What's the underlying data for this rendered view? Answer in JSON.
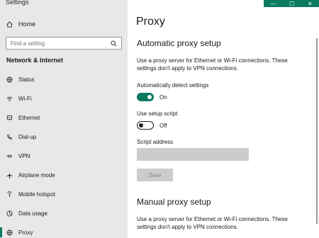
{
  "app": {
    "title": "Settings"
  },
  "sidebar": {
    "home_label": "Home",
    "search_placeholder": "Find a setting",
    "section_label": "Network & Internet",
    "items": [
      {
        "label": "Status",
        "icon": "globe-icon"
      },
      {
        "label": "Wi-Fi",
        "icon": "wifi-icon"
      },
      {
        "label": "Ethernet",
        "icon": "ethernet-icon"
      },
      {
        "label": "Dial-up",
        "icon": "phone-icon"
      },
      {
        "label": "VPN",
        "icon": "vpn-icon"
      },
      {
        "label": "Airplane mode",
        "icon": "airplane-icon"
      },
      {
        "label": "Mobile hotspot",
        "icon": "hotspot-icon"
      },
      {
        "label": "Data usage",
        "icon": "data-usage-icon"
      },
      {
        "label": "Proxy",
        "icon": "globe-icon",
        "selected": true
      }
    ]
  },
  "window_controls": {
    "minimize": "—",
    "maximize": "☐",
    "close": "✕"
  },
  "main": {
    "title": "Proxy",
    "automatic": {
      "heading": "Automatic proxy setup",
      "description": "Use a proxy server for Ethernet or Wi-Fi connections. These settings don't apply to VPN connections.",
      "auto_detect_label": "Automatically detect settings",
      "auto_detect_state": "On",
      "auto_detect_on": true,
      "setup_script_label": "Use setup script",
      "setup_script_state": "Off",
      "setup_script_on": false,
      "script_address_label": "Script address",
      "script_address_value": "",
      "save_label": "Save"
    },
    "manual": {
      "heading": "Manual proxy setup",
      "description": "Use a proxy server for Ethernet or Wi-Fi connections. These settings don't apply to VPN connections."
    }
  },
  "colors": {
    "accent": "#0a7a63",
    "sidebar_bg": "#e8e8e8",
    "disabled": "#cccccc"
  }
}
